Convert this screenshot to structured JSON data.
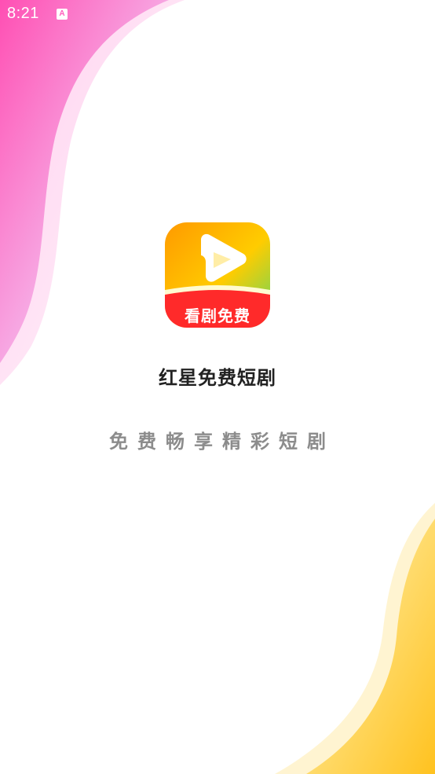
{
  "status_bar": {
    "time": "8:21",
    "notification_icon": "A"
  },
  "logo": {
    "caption": "看剧免费",
    "icon": "play-triangle-icon"
  },
  "app_name": "红星免费短剧",
  "slogan": "免费畅享精彩短剧",
  "colors": {
    "pink": "#ff4fb3",
    "yellow": "#ffc72e",
    "logo_orange": "#ff9a00",
    "logo_green": "#5ed864",
    "logo_red": "#ff2a2a"
  }
}
